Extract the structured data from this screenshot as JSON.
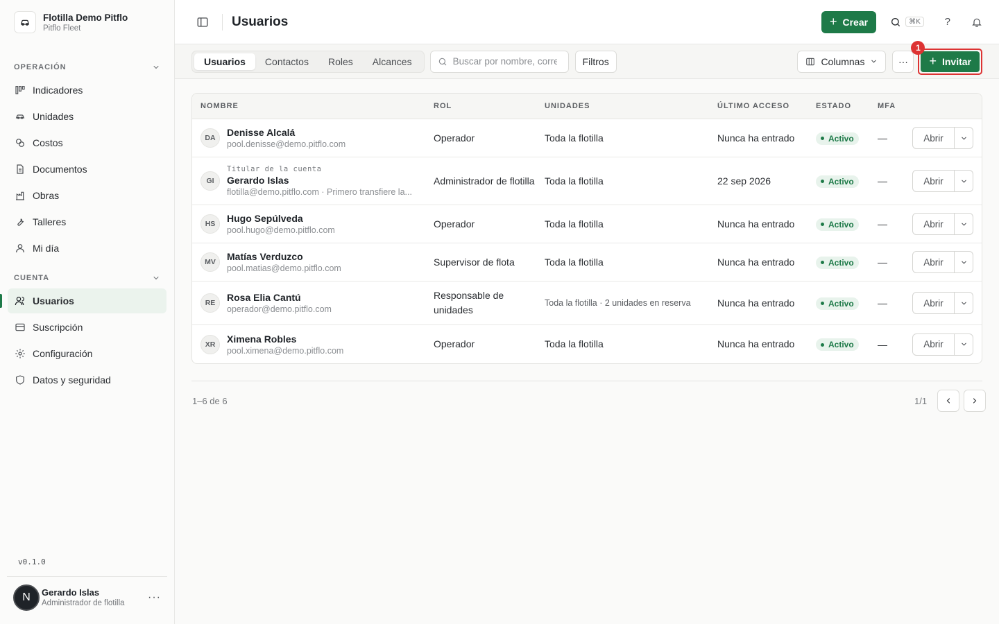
{
  "org": {
    "name": "Flotilla Demo Pitflo",
    "subtitle": "Pitflo Fleet"
  },
  "sidebar": {
    "section_operation": "OPERACIÓN",
    "operation_items": [
      {
        "label": "Indicadores",
        "icon": "kanban-icon"
      },
      {
        "label": "Unidades",
        "icon": "car-icon"
      },
      {
        "label": "Costos",
        "icon": "coins-icon"
      },
      {
        "label": "Documentos",
        "icon": "document-icon"
      },
      {
        "label": "Obras",
        "icon": "factory-icon"
      },
      {
        "label": "Talleres",
        "icon": "wrench-icon"
      },
      {
        "label": "Mi día",
        "icon": "user-icon"
      }
    ],
    "section_account": "CUENTA",
    "account_items": [
      {
        "label": "Usuarios",
        "icon": "users-icon",
        "active": true
      },
      {
        "label": "Suscripción",
        "icon": "card-icon"
      },
      {
        "label": "Configuración",
        "icon": "gear-icon"
      },
      {
        "label": "Datos y seguridad",
        "icon": "shield-icon"
      }
    ],
    "version": "v0.1.0",
    "user": {
      "initial": "N",
      "name": "Gerardo Islas",
      "role": "Administrador de flotilla"
    }
  },
  "header": {
    "title": "Usuarios",
    "create_label": "Crear",
    "shortcut": "⌘K",
    "help": "?"
  },
  "subbar": {
    "tabs": [
      "Usuarios",
      "Contactos",
      "Roles",
      "Alcances"
    ],
    "search_placeholder": "Buscar por nombre, correo",
    "filters_label": "Filtros",
    "columns_label": "Columnas",
    "more_label": "···",
    "invite_label": "Invitar",
    "badge": "1"
  },
  "table": {
    "headers": {
      "name": "NOMBRE",
      "role": "ROL",
      "units": "UNIDADES",
      "last_access": "ÚLTIMO ACCESO",
      "status": "ESTADO",
      "mfa": "MFA"
    },
    "open_label": "Abrir",
    "rows": [
      {
        "initials": "DA",
        "title": "",
        "name": "Denisse Alcalá",
        "email": "pool.denisse@demo.pitflo.com",
        "role": "Operador",
        "units": "Toda la flotilla",
        "last_access": "Nunca ha entrado",
        "status": "Activo",
        "mfa": "—"
      },
      {
        "initials": "GI",
        "title": "Titular de la cuenta",
        "name": "Gerardo Islas",
        "email": "flotilla@demo.pitflo.com · Primero transfiere la...",
        "role": "Administrador de flotilla",
        "units": "Toda la flotilla",
        "last_access": "22 sep 2026",
        "status": "Activo",
        "mfa": "—"
      },
      {
        "initials": "HS",
        "title": "",
        "name": "Hugo Sepúlveda",
        "email": "pool.hugo@demo.pitflo.com",
        "role": "Operador",
        "units": "Toda la flotilla",
        "last_access": "Nunca ha entrado",
        "status": "Activo",
        "mfa": "—"
      },
      {
        "initials": "MV",
        "title": "",
        "name": "Matías Verduzco",
        "email": "pool.matias@demo.pitflo.com",
        "role": "Supervisor de flota",
        "units": "Toda la flotilla",
        "last_access": "Nunca ha entrado",
        "status": "Activo",
        "mfa": "—"
      },
      {
        "initials": "RE",
        "title": "",
        "name": "Rosa Elia Cantú",
        "email": "operador@demo.pitflo.com",
        "role": "Responsable de unidades",
        "units": "Toda la flotilla · 2 unidades en reserva",
        "last_access": "Nunca ha entrado",
        "status": "Activo",
        "mfa": "—"
      },
      {
        "initials": "XR",
        "title": "",
        "name": "Ximena Robles",
        "email": "pool.ximena@demo.pitflo.com",
        "role": "Operador",
        "units": "Toda la flotilla",
        "last_access": "Nunca ha entrado",
        "status": "Activo",
        "mfa": "—"
      }
    ]
  },
  "pagination": {
    "range": "1–6 de 6",
    "page": "1/1"
  },
  "colors": {
    "accent": "#1e7a48",
    "highlight": "#dd3333"
  }
}
